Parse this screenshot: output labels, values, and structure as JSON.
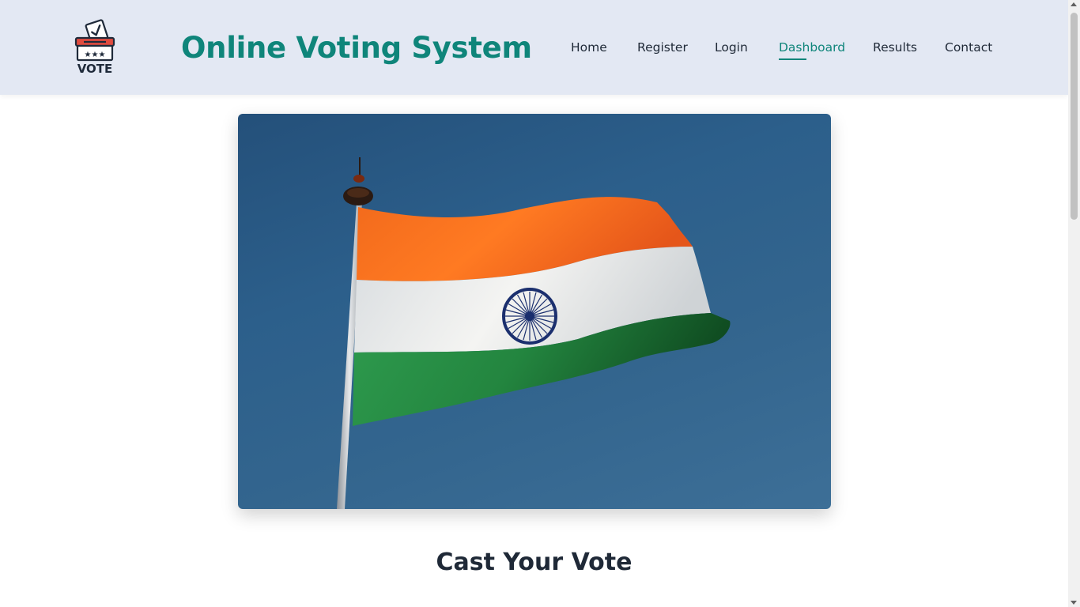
{
  "brand": {
    "logo_text": "VOTE",
    "title": "Online Voting System",
    "accent_color": "#0f857a"
  },
  "nav": {
    "items": [
      {
        "label": "Home",
        "active": false
      },
      {
        "label": "Register",
        "active": false
      },
      {
        "label": "Login",
        "active": false
      },
      {
        "label": "Dashboard",
        "active": true
      },
      {
        "label": "Results",
        "active": false
      },
      {
        "label": "Contact",
        "active": false
      }
    ]
  },
  "hero": {
    "image": "indian-flag-on-pole-against-blue-sky"
  },
  "main": {
    "section_title": "Cast Your Vote"
  }
}
